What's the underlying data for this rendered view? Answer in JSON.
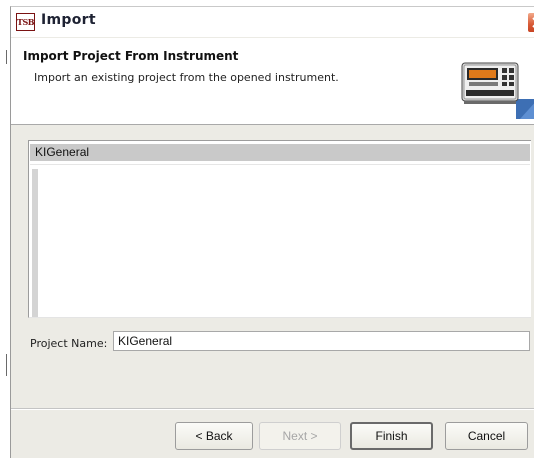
{
  "window": {
    "logo_text": "TSB",
    "title": "Import",
    "close_icon": "close-icon"
  },
  "header": {
    "title": "Import Project From Instrument",
    "description": "Import an existing project from the opened instrument.",
    "icon": "instrument-icon"
  },
  "projects": {
    "items": [
      "KIGeneral"
    ],
    "selected": "KIGeneral"
  },
  "project_name": {
    "label": "Project Name:",
    "value": "KIGeneral"
  },
  "buttons": {
    "back": "< Back",
    "next": "Next >",
    "finish": "Finish",
    "cancel": "Cancel"
  },
  "colors": {
    "selection": "#c9c9c9",
    "dialog_background": "#ecebe5",
    "close_button": "#d75a36"
  }
}
